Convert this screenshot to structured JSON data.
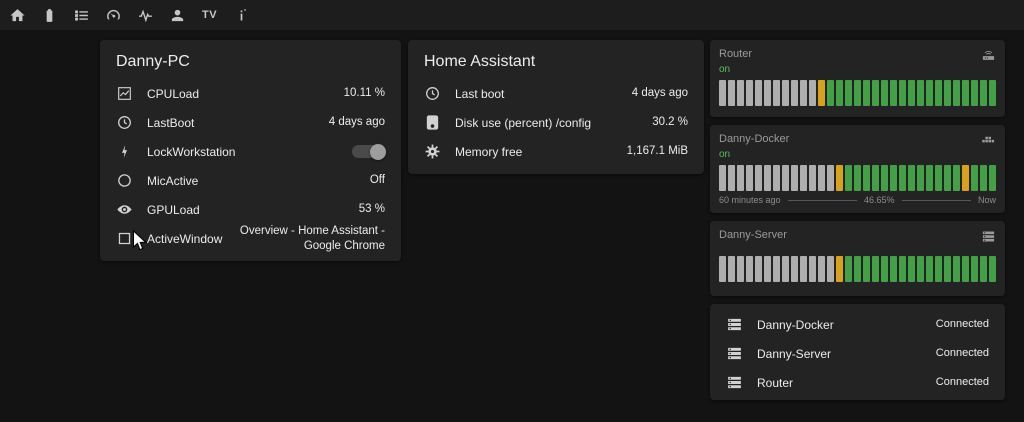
{
  "topbar": {
    "icons": [
      {
        "name": "home"
      },
      {
        "name": "battery"
      },
      {
        "name": "list"
      },
      {
        "name": "gauge"
      },
      {
        "name": "pulse"
      },
      {
        "name": "account"
      },
      {
        "name": "tv",
        "text": "TV"
      },
      {
        "name": "info"
      }
    ]
  },
  "cards": {
    "danny_pc": {
      "title": "Danny-PC",
      "rows": [
        {
          "icon": "chart-line",
          "label": "CPULoad",
          "value": "10.11 %",
          "type": "text"
        },
        {
          "icon": "clock",
          "label": "LastBoot",
          "value": "4 days ago",
          "type": "text"
        },
        {
          "icon": "flash",
          "label": "LockWorkstation",
          "value": "off",
          "type": "toggle"
        },
        {
          "icon": "circle",
          "label": "MicActive",
          "value": "Off",
          "type": "text"
        },
        {
          "icon": "eye",
          "label": "GPULoad",
          "value": "53 %",
          "type": "text"
        },
        {
          "icon": "window",
          "label": "ActiveWindow",
          "value": "Overview - Home Assistant - Google Chrome",
          "type": "text"
        }
      ]
    },
    "home_assistant": {
      "title": "Home Assistant",
      "rows": [
        {
          "icon": "clock",
          "label": "Last boot",
          "value": "4 days ago",
          "type": "text"
        },
        {
          "icon": "harddisk",
          "label": "Disk use (percent) /config",
          "value": "30.2 %",
          "type": "text"
        },
        {
          "icon": "gear",
          "label": "Memory free",
          "value": "1,167.1 MiB",
          "type": "text"
        }
      ]
    }
  },
  "graphs": {
    "router": {
      "title": "Router",
      "state": "on",
      "icon": "router",
      "segments": [
        [
          "off",
          11
        ],
        [
          "warn",
          1
        ],
        [
          "on",
          19
        ]
      ]
    },
    "docker": {
      "title": "Danny-Docker",
      "state": "on",
      "icon": "docker",
      "segments": [
        [
          "off",
          13
        ],
        [
          "warn",
          1
        ],
        [
          "on",
          13
        ],
        [
          "warn",
          1
        ],
        [
          "on",
          3
        ]
      ],
      "footer": {
        "left": "60 minutes ago",
        "center": "46.65%",
        "right": "Now"
      }
    },
    "server": {
      "title": "Danny-Server",
      "state": "",
      "icon": "server",
      "segments": [
        [
          "off",
          13
        ],
        [
          "warn",
          1
        ],
        [
          "on",
          17
        ]
      ]
    }
  },
  "connections": {
    "rows": [
      {
        "icon": "server",
        "label": "Danny-Docker",
        "value": "Connected",
        "type": "text"
      },
      {
        "icon": "server",
        "label": "Danny-Server",
        "value": "Connected",
        "type": "text"
      },
      {
        "icon": "server",
        "label": "Router",
        "value": "Connected",
        "type": "text"
      }
    ]
  },
  "colors": {
    "bar_off": "#aeaeae",
    "bar_warn": "#d9a21b",
    "bar_on": "#43a047",
    "state_on": "#5dbb63"
  }
}
